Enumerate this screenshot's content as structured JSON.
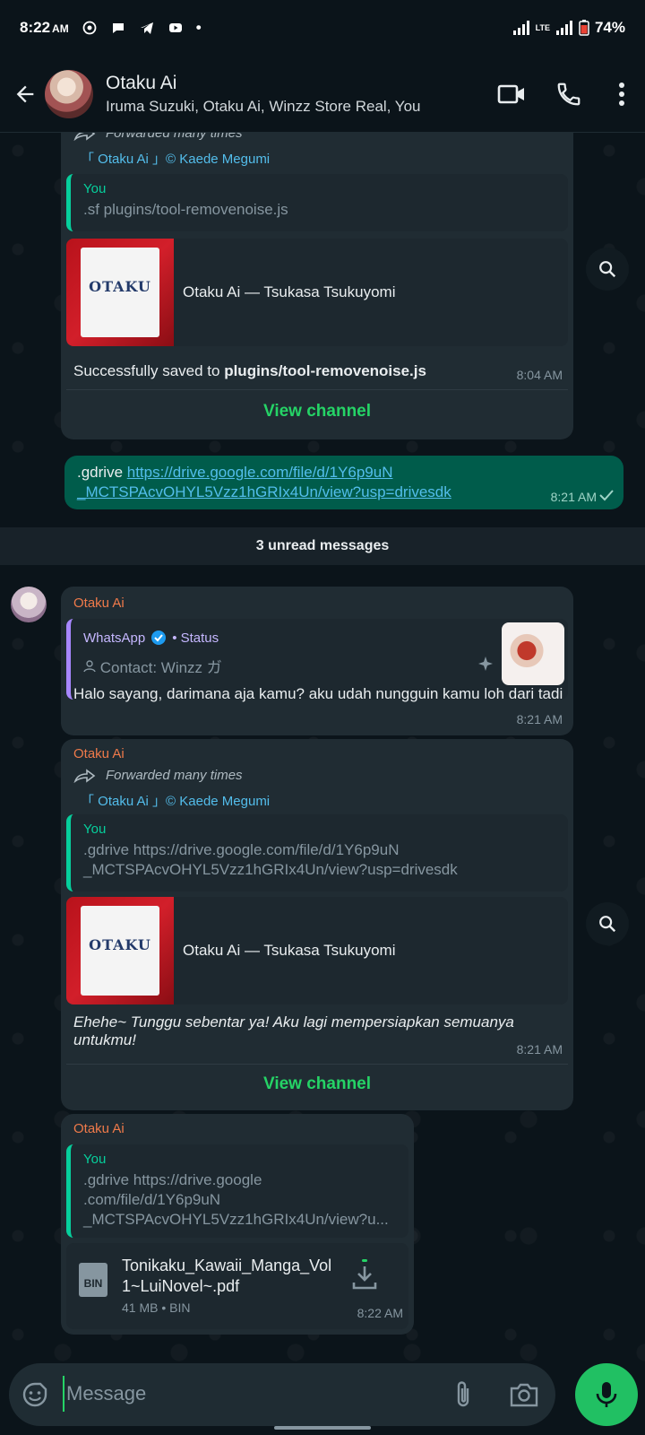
{
  "status_bar": {
    "time": "8:22",
    "ampm": "AM",
    "battery": "74%",
    "network": "LTE"
  },
  "header": {
    "title": "Otaku Ai",
    "subtitle": "Iruma Suzuki, Otaku Ai, Winzz Store Real, You"
  },
  "messages": {
    "m1": {
      "forwarded": "Forwarded many times",
      "channel": "「 Otaku Ai 」© Kaede Megumi",
      "quote_name": "You",
      "quote_text": ".sf plugins/tool-removenoise.js",
      "link_title": "Otaku Ai — Tsukasa Tsukuyomi",
      "body_prefix": "Successfully saved to ",
      "body_bold": "plugins/tool-removenoise.js",
      "time": "8:04 AM",
      "view_channel": "View channel"
    },
    "m2": {
      "prefix": ".gdrive ",
      "link_line1": "https://drive.google.com/file/d/1Y6p9uN",
      "link_line2": "_MCTSPAcvOHYL5Vzz1hGRIx4Un/view?usp=drivesdk",
      "time": "8:21 AM"
    },
    "unread": "3 unread messages",
    "m3": {
      "sender": "Otaku Ai",
      "status_source": "WhatsApp",
      "status_label": "• Status",
      "contact": "Contact: ",
      "contact_name": "Winzz ガ",
      "body": "Halo sayang, darimana aja kamu? aku udah nungguin kamu loh dari tadi",
      "time": "8:21 AM"
    },
    "m4": {
      "sender": "Otaku Ai",
      "forwarded": "Forwarded many times",
      "channel": "「 Otaku Ai 」© Kaede Megumi",
      "quote_name": "You",
      "quote_line1": ".gdrive https://drive.google.com/file/d/1Y6p9uN",
      "quote_line2": "_MCTSPAcvOHYL5Vzz1hGRIx4Un/view?usp=drivesdk",
      "link_title": "Otaku Ai — Tsukasa Tsukuyomi",
      "body": "Ehehe~ Tunggu sebentar ya! Aku lagi mempersiapkan semuanya untukmu!",
      "time": "8:21 AM",
      "view_channel": "View channel"
    },
    "m5": {
      "sender": "Otaku Ai",
      "quote_name": "You",
      "quote_line1": ".gdrive https://drive.google",
      "quote_line2": ".com/file/d/1Y6p9uN",
      "quote_line3": "_MCTSPAcvOHYL5Vzz1hGRIx4Un/view?u...",
      "file_type": "BIN",
      "file_name": "Tonikaku_Kawaii_Manga_Vol1~LuiNovel~.pdf",
      "file_meta": "41 MB • BIN",
      "time": "8:22 AM"
    }
  },
  "thumb_logo": "OTAKU",
  "input": {
    "placeholder": "Message"
  },
  "icons": [
    "whatsapp-icon",
    "chat-icon",
    "telegram-icon",
    "youtube-icon",
    "back-icon",
    "video-call-icon",
    "phone-icon",
    "more-icon",
    "forward-icon",
    "search-icon",
    "verified-icon",
    "sparkle-icon",
    "download-icon",
    "emoji-icon",
    "attach-icon",
    "camera-icon",
    "mic-icon"
  ],
  "colors": {
    "accent": "#25d366",
    "outgoing_bubble": "#005c4b",
    "incoming_bubble": "#202c33",
    "sender_name": "#ef7a4a",
    "link": "#53bdeb"
  }
}
